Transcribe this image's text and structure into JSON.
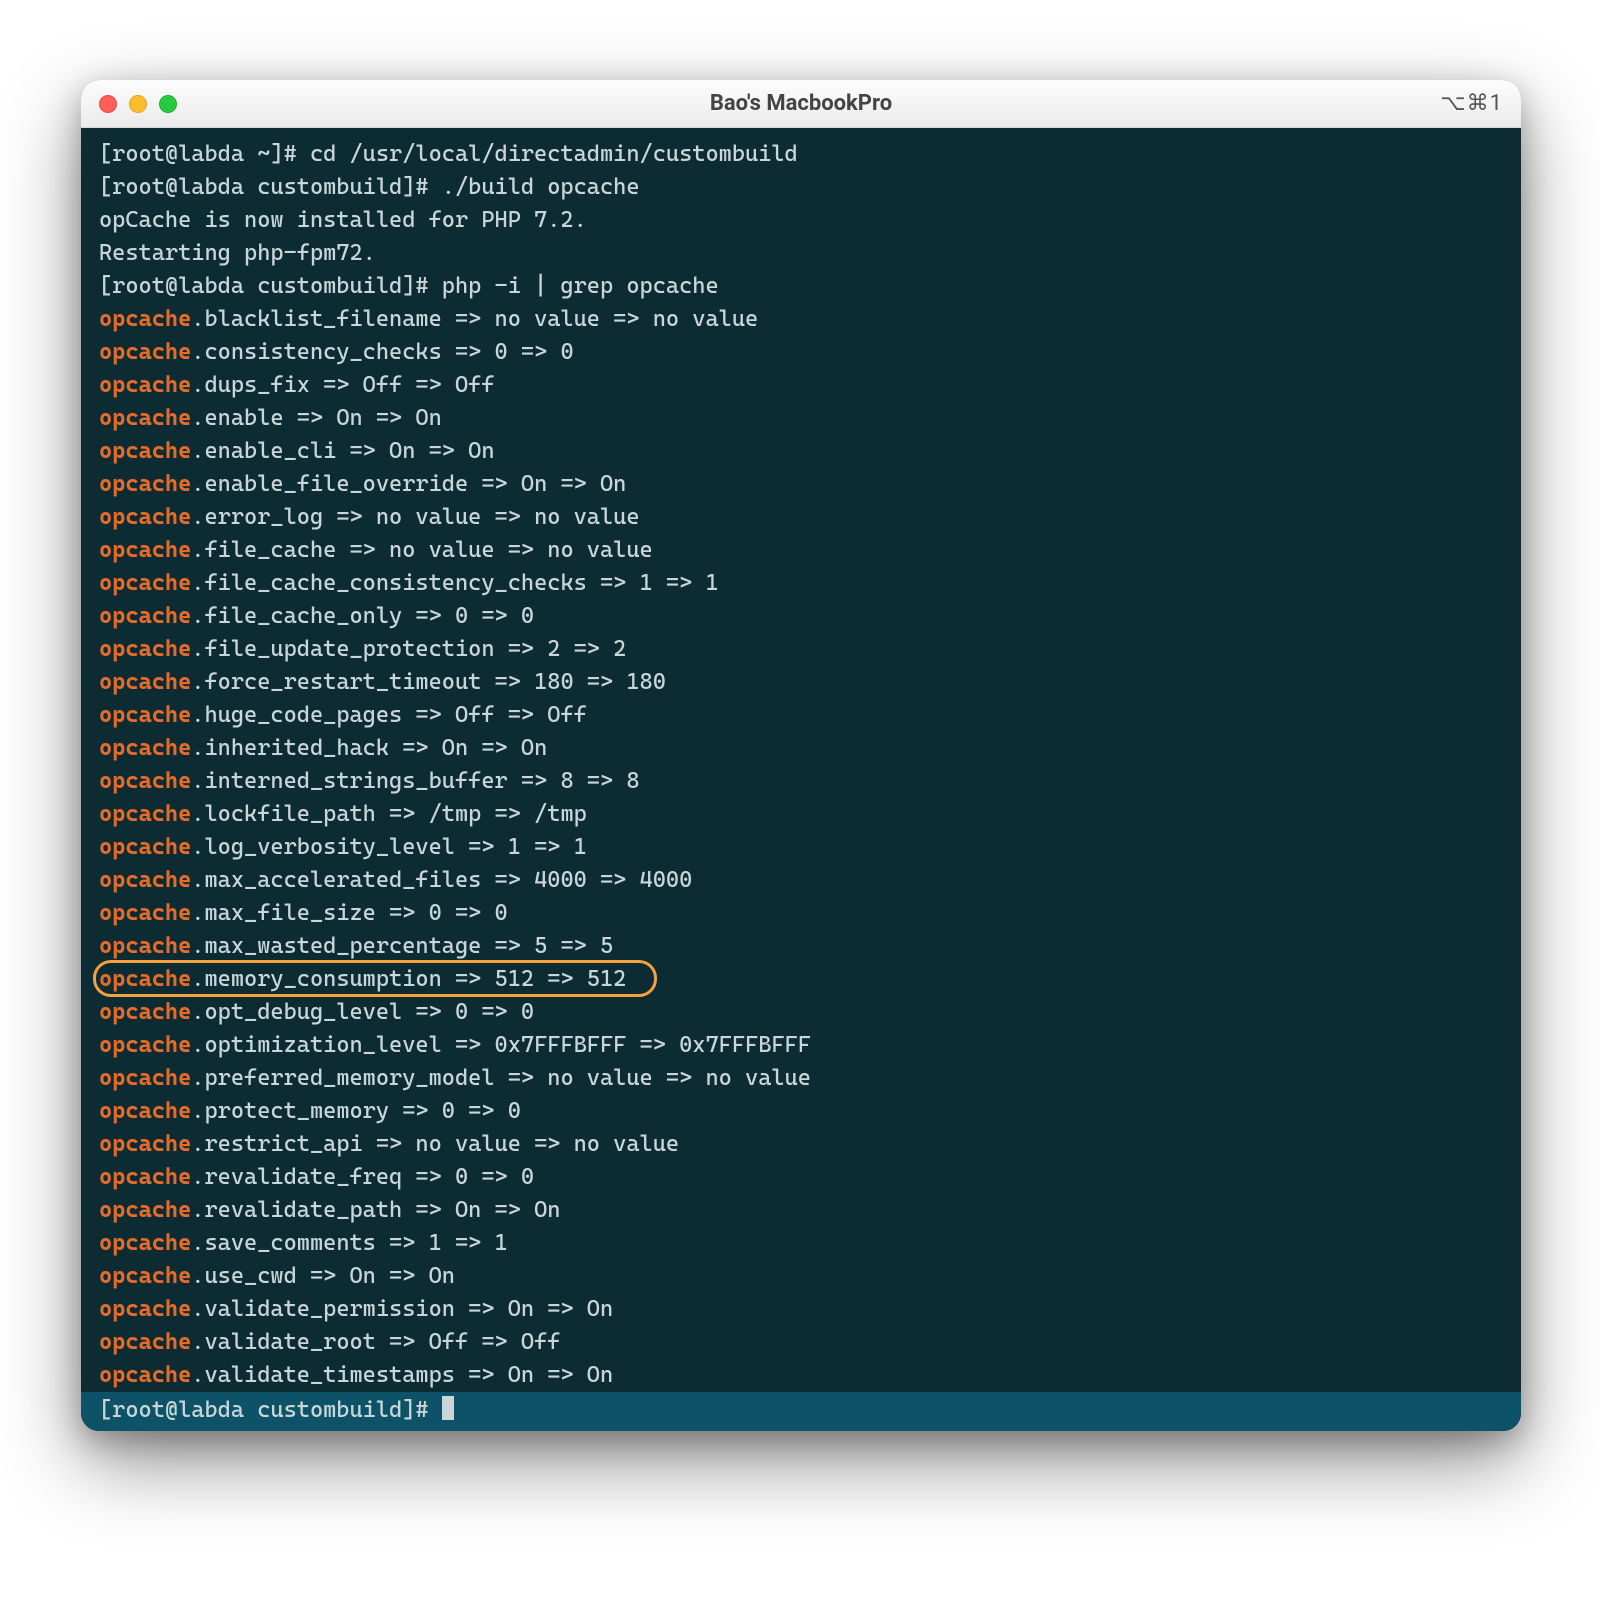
{
  "window": {
    "title": "Bao's MacbookPro",
    "shortcut": "⌥⌘1"
  },
  "colors": {
    "highlight": "#e46b29",
    "term_bg": "#0c2b33",
    "prompt_bg": "#0d5266",
    "ring": "#f7a13c"
  },
  "prompt_lines": [
    "[root@labda ~]# cd /usr/local/directadmin/custombuild",
    "[root@labda custombuild]# ./build opcache",
    "opCache is now installed for PHP 7.2.",
    "Restarting php-fpm72.",
    "[root@labda custombuild]# php -i | grep opcache"
  ],
  "settings": [
    {
      "key": "opcache",
      "rest": ".blacklist_filename => no value => no value"
    },
    {
      "key": "opcache",
      "rest": ".consistency_checks => 0 => 0"
    },
    {
      "key": "opcache",
      "rest": ".dups_fix => Off => Off"
    },
    {
      "key": "opcache",
      "rest": ".enable => On => On"
    },
    {
      "key": "opcache",
      "rest": ".enable_cli => On => On"
    },
    {
      "key": "opcache",
      "rest": ".enable_file_override => On => On"
    },
    {
      "key": "opcache",
      "rest": ".error_log => no value => no value"
    },
    {
      "key": "opcache",
      "rest": ".file_cache => no value => no value"
    },
    {
      "key": "opcache",
      "rest": ".file_cache_consistency_checks => 1 => 1"
    },
    {
      "key": "opcache",
      "rest": ".file_cache_only => 0 => 0"
    },
    {
      "key": "opcache",
      "rest": ".file_update_protection => 2 => 2"
    },
    {
      "key": "opcache",
      "rest": ".force_restart_timeout => 180 => 180"
    },
    {
      "key": "opcache",
      "rest": ".huge_code_pages => Off => Off"
    },
    {
      "key": "opcache",
      "rest": ".inherited_hack => On => On"
    },
    {
      "key": "opcache",
      "rest": ".interned_strings_buffer => 8 => 8"
    },
    {
      "key": "opcache",
      "rest": ".lockfile_path => /tmp => /tmp"
    },
    {
      "key": "opcache",
      "rest": ".log_verbosity_level => 1 => 1"
    },
    {
      "key": "opcache",
      "rest": ".max_accelerated_files => 4000 => 4000"
    },
    {
      "key": "opcache",
      "rest": ".max_file_size => 0 => 0"
    },
    {
      "key": "opcache",
      "rest": ".max_wasted_percentage => 5 => 5"
    },
    {
      "key": "opcache",
      "rest": ".memory_consumption => 512 => 512",
      "highlighted": true
    },
    {
      "key": "opcache",
      "rest": ".opt_debug_level => 0 => 0"
    },
    {
      "key": "opcache",
      "rest": ".optimization_level => 0x7FFFBFFF => 0x7FFFBFFF"
    },
    {
      "key": "opcache",
      "rest": ".preferred_memory_model => no value => no value"
    },
    {
      "key": "opcache",
      "rest": ".protect_memory => 0 => 0"
    },
    {
      "key": "opcache",
      "rest": ".restrict_api => no value => no value"
    },
    {
      "key": "opcache",
      "rest": ".revalidate_freq => 0 => 0"
    },
    {
      "key": "opcache",
      "rest": ".revalidate_path => On => On"
    },
    {
      "key": "opcache",
      "rest": ".save_comments => 1 => 1"
    },
    {
      "key": "opcache",
      "rest": ".use_cwd => On => On"
    },
    {
      "key": "opcache",
      "rest": ".validate_permission => On => On"
    },
    {
      "key": "opcache",
      "rest": ".validate_root => Off => Off"
    },
    {
      "key": "opcache",
      "rest": ".validate_timestamps => On => On"
    }
  ],
  "final_prompt": "[root@labda custombuild]# "
}
